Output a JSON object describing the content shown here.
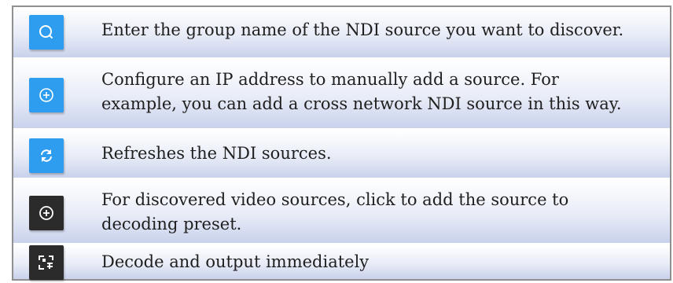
{
  "rows": [
    {
      "icon": "search-icon",
      "icon_color": "#2e9df0",
      "lines": [
        "Enter the group name of the NDI source you want to discover."
      ]
    },
    {
      "icon": "add-circle-icon",
      "icon_color": "#2e9df0",
      "lines": [
        "Configure an IP address to manually add a source.  For",
        "example, you can add a cross network NDI source in this way."
      ]
    },
    {
      "icon": "refresh-icon",
      "icon_color": "#2e9df0",
      "lines": [
        "Refreshes the NDI sources."
      ]
    },
    {
      "icon": "add-circle-icon",
      "icon_color": "#2b2b2b",
      "lines": [
        "For discovered video sources, click to add the source to",
        "decoding preset."
      ]
    },
    {
      "icon": "decode-output-icon",
      "icon_color": "#2b2b2b",
      "lines": [
        "Decode and output immediately"
      ]
    }
  ]
}
